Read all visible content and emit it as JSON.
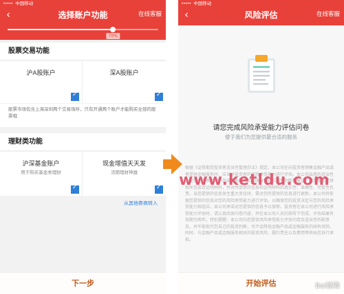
{
  "left_screen": {
    "status": {
      "carrier": "中国移动"
    },
    "header": {
      "title": "选择账户功能",
      "service": "在线客服"
    },
    "progress": {
      "value": 0.7,
      "label": "70%"
    },
    "stock": {
      "title": "股票交易功能",
      "options": [
        {
          "name": "沪A股账户"
        },
        {
          "name": "深A股账户"
        }
      ],
      "note": "股票市场包含上海深圳两个交易场所，只有开通两个账户才能购买全部的股票哦"
    },
    "finance": {
      "title": "理财类功能",
      "options": [
        {
          "name": "沪深基金账户",
          "sub": "用于购买基金类理财"
        },
        {
          "name": "现金增值天天发",
          "sub": "活期理财神器"
        }
      ],
      "transfer_link": "从其他券商转入"
    },
    "footer": {
      "next": "下一步"
    }
  },
  "right_screen": {
    "status": {
      "carrier": "中国移动"
    },
    "header": {
      "title": "风险评估",
      "service": "在线客服"
    },
    "questionnaire": {
      "title": "请您完成风险承受能力评估问卷",
      "subtitle": "便于我们为您提供最合适的服务"
    },
    "fine_print": "根据《证券期货投资者适当性管理办法》规定，本公司在向投资者销售金融产品或者提供金融服务时，应当对投资者的风险承受能力进行评估。本公司出具的适当性匹配意见不表明对产品或服务的风险和收益做出实质性判断和保证。请您如实提供相关信息及证明材料，并对所提供的信息和证明材料的真实性、准确性、完整性负责。当您提供的信息发生重大变化时，需对您所提供的信息进行更新，本公司将依据您提供的信息对您的风险承受能力进行评估。以确保您的投资决定与您的风险承受能力相适应。本公司承诺对您提供的信息予以保密。投资者在本公司进行风险承受能力评估时，请认真阅读问卷内容，并在本公司人员的指导下完成，评估结果有效期为两年。特别提醒：本公司向您提供风险承受能力评估问卷及适当性匹配意见，并不能取代您自己的投资判断，也不会降低金融产品或金融服务的固有风险。同时，与金融产品或金融服务相关的投资风险、履约责任以及费用等将由您自行承担。",
    "footer": {
      "start": "开始评估"
    }
  },
  "watermark": {
    "text": "www.ketldu.com",
    "badge": "Bai经验"
  },
  "colors": {
    "brand_red": "#e8413a",
    "accent_blue": "#2f7fd8",
    "footer_text": "#c05a1a",
    "arrow_orange": "#f08a1c"
  }
}
